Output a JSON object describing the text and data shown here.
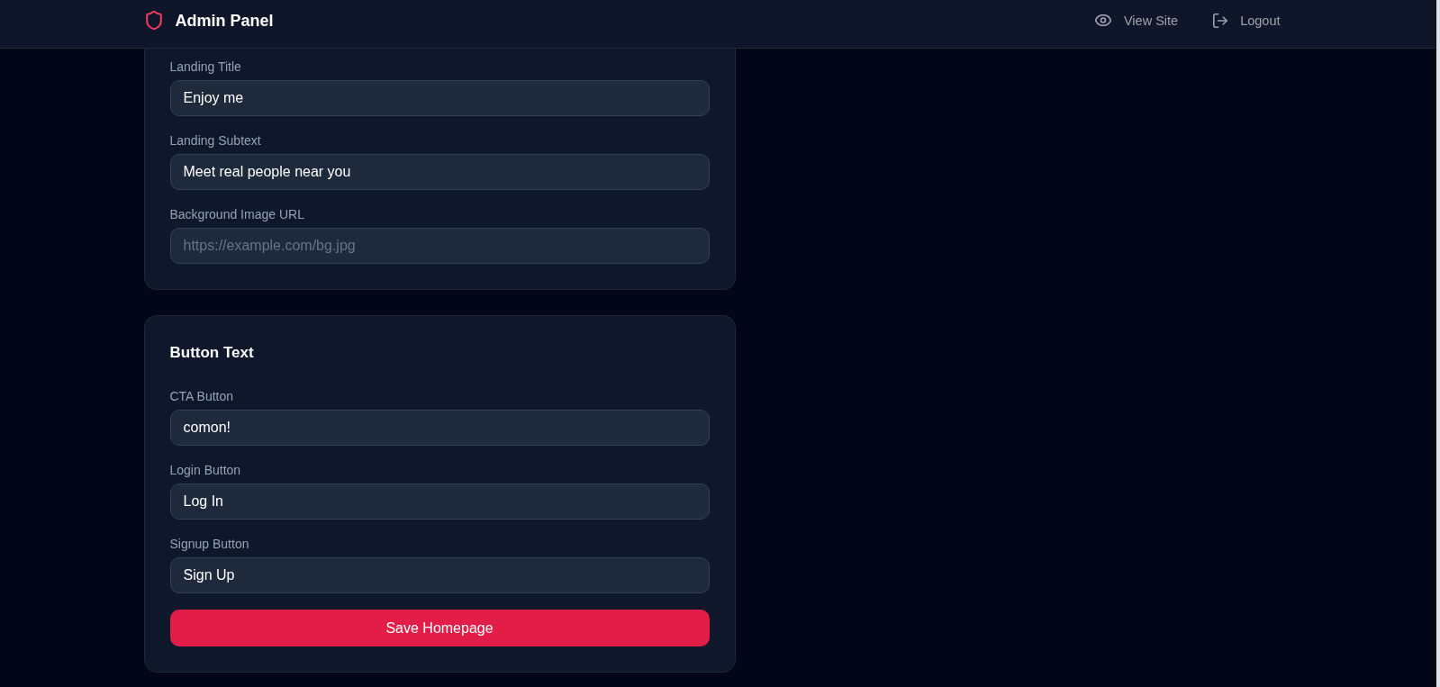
{
  "navbar": {
    "title": "Admin Panel",
    "links": [
      {
        "label": "View Site",
        "kind": "view"
      },
      {
        "label": "Logout",
        "kind": "logout"
      }
    ]
  },
  "sections": [
    {
      "fields": [
        {
          "label": "Landing Title",
          "value": "Enjoy me"
        },
        {
          "label": "Landing Subtext",
          "value": "Meet real people near you"
        },
        {
          "label": "Background Image URL",
          "placeholder": "https://example.com/bg.jpg"
        }
      ]
    },
    {
      "title": "Button Text",
      "fields": [
        {
          "label": "CTA Button",
          "value": "comon!"
        },
        {
          "label": "Login Button",
          "value": "Log In"
        },
        {
          "label": "Signup Button",
          "value": "Sign Up"
        }
      ],
      "save_button": {
        "label": "Save Homepage"
      }
    }
  ]
}
